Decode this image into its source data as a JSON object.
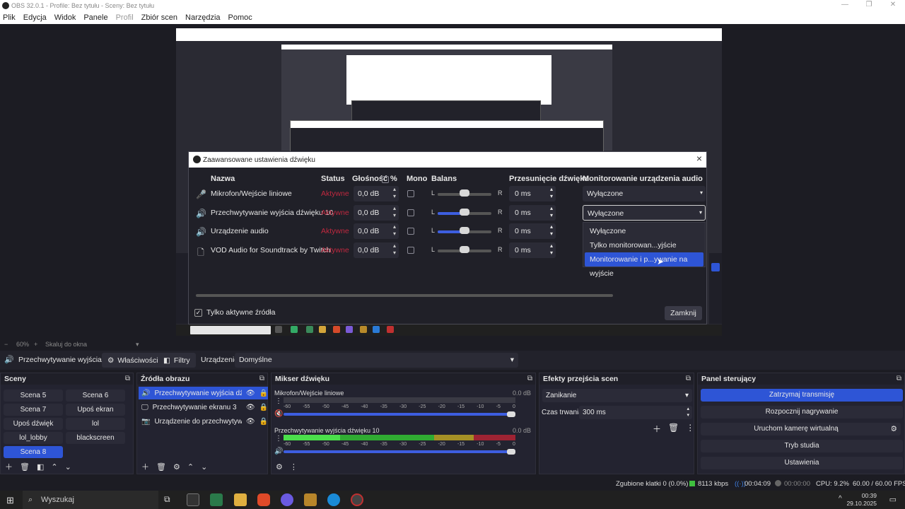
{
  "window": {
    "title": "OBS 32.0.1 - Profile: Bez tytułu - Sceny: Bez tytułu",
    "controls": [
      "—",
      "❐",
      "✕"
    ]
  },
  "menu": [
    {
      "label": "Plik",
      "enabled": true
    },
    {
      "label": "Edycja",
      "enabled": true
    },
    {
      "label": "Widok",
      "enabled": true
    },
    {
      "label": "Panele",
      "enabled": true
    },
    {
      "label": "Profil",
      "enabled": false
    },
    {
      "label": "Zbiór scen",
      "enabled": true
    },
    {
      "label": "Narzędzia",
      "enabled": true
    },
    {
      "label": "Pomoc",
      "enabled": true
    }
  ],
  "dialog": {
    "title": "Zaawansowane ustawienia dźwięku",
    "close": "×",
    "headers": {
      "name": "Nazwa",
      "status": "Status",
      "volume": "Głośność",
      "percent": "%",
      "mono": "Mono",
      "balance": "Balans",
      "offset": "Przesunięcie dźwięku",
      "monitoring": "Monitorowanie urządzenia audio"
    },
    "rows": [
      {
        "icon": "microphone-icon",
        "glyph": "🎤",
        "name": "Mikrofon/Wejście liniowe",
        "status": "Aktywne",
        "volume": "0,0 dB",
        "balance_fraction": 0.5,
        "active": false,
        "offset": "0 ms",
        "monitoring": "Wyłączone"
      },
      {
        "icon": "speaker-icon",
        "glyph": "🔊",
        "name": "Przechwytywanie wyjścia dźwięku 10",
        "status": "Aktywne",
        "volume": "0,0 dB",
        "balance_fraction": 0.5,
        "active": true,
        "offset": "0 ms",
        "monitoring": "Wyłączone"
      },
      {
        "icon": "speaker-icon",
        "glyph": "🔊",
        "name": "Urządzenie audio",
        "status": "Aktywne",
        "volume": "0,0 dB",
        "balance_fraction": 0.5,
        "active": true,
        "offset": "0 ms",
        "monitoring": ""
      },
      {
        "icon": "file-icon",
        "glyph": "🗋",
        "name": "VOD Audio for Soundtrack by Twitch",
        "status": "Aktywne",
        "volume": "0,0 dB",
        "balance_fraction": 0.5,
        "active": false,
        "offset": "0 ms",
        "monitoring": ""
      }
    ],
    "balance_L": "L",
    "balance_R": "R",
    "dropdown_options": [
      "Wyłączone",
      "Tylko monitorowan...yjście wyłączone)",
      "Monitorowanie i p...ywanie na wyjście"
    ],
    "dropdown_selected_index": 2,
    "only_active_label": "Tylko aktywne źródła",
    "close_button": "Zamknij"
  },
  "zoom": {
    "value": "60%",
    "mode": "Skaluj do okna"
  },
  "propbar": {
    "source": "Przechwytywanie wyjścia d",
    "properties": "Właściwości",
    "filters": "Filtry",
    "device_label": "Urządzenie",
    "device_value": "Domyślne"
  },
  "scenes": {
    "title": "Sceny",
    "items": [
      "Scena 5",
      "Scena 6",
      "Scena 7",
      "Upoś ekran",
      "Upoś dźwięk",
      "lol",
      "lol_lobby",
      "blackscreen",
      "Scena 8"
    ],
    "selected": "Scena 8"
  },
  "sources": {
    "title": "Źródła obrazu",
    "items": [
      {
        "label": "Przechwytywanie wyjścia dźwię",
        "icon": "speaker-icon",
        "glyph": "🔊",
        "selected": true
      },
      {
        "label": "Przechwytywanie ekranu 3",
        "icon": "monitor-icon",
        "glyph": "🖵",
        "selected": false
      },
      {
        "label": "Urządzenie do przechwytywani",
        "icon": "camera-icon",
        "glyph": "📷",
        "selected": false
      }
    ]
  },
  "mixer": {
    "title": "Mikser dźwięku",
    "channels": [
      {
        "name": "Mikrofon/Wejście liniowe",
        "db": "0.0 dB",
        "level_fraction": 0,
        "muted": true
      },
      {
        "name": "Przechwytywanie wyjścia dźwięku 10",
        "db": "0.0 dB",
        "level_fraction": 0.7,
        "muted": false
      }
    ],
    "scale": [
      "-60",
      "-55",
      "-50",
      "-45",
      "-40",
      "-35",
      "-30",
      "-25",
      "-20",
      "-15",
      "-10",
      "-5",
      "0"
    ]
  },
  "transitions": {
    "title": "Efekty przejścia scen",
    "selected": "Zanikanie",
    "duration_label": "Czas trwania",
    "duration": "300 ms"
  },
  "controls": {
    "title": "Panel sterujący",
    "buttons": [
      {
        "label": "Zatrzymaj transmisję",
        "active": true
      },
      {
        "label": "Rozpocznij nagrywanie",
        "active": false
      },
      {
        "label": "Uruchom kamerę wirtualną",
        "active": false
      },
      {
        "label": "Tryb studia",
        "active": false
      },
      {
        "label": "Ustawienia",
        "active": false
      }
    ]
  },
  "status": {
    "dropped": "Zgubione klatki 0 (0.0%)",
    "bitrate": "8113 kbps",
    "stream_time": "00:04:09",
    "rec_time": "00:00:00",
    "cpu": "CPU: 9.2%",
    "fps": "60.00 / 60.00 FPS"
  },
  "taskbar": {
    "search": "Wyszukaj",
    "time": "00:39",
    "date": "29.10.2025"
  },
  "colors": {
    "accent": "#2e55d6",
    "status_red": "#c0283f",
    "meter_green": "#2fbf2f",
    "meter_yellow": "#b8a020",
    "meter_red": "#b02030"
  }
}
